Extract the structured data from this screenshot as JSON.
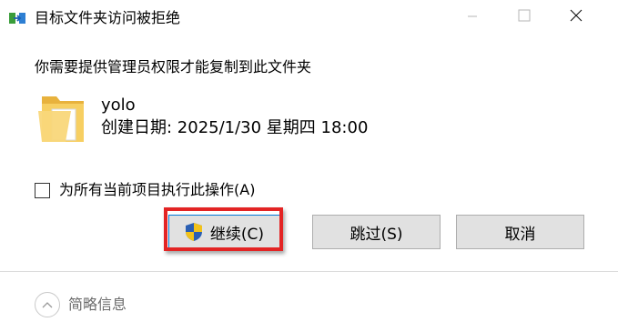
{
  "window": {
    "title": "目标文件夹访问被拒绝"
  },
  "dialog": {
    "prompt": "你需要提供管理员权限才能复制到此文件夹",
    "item": {
      "name": "yolo",
      "created": "创建日期: 2025/1/30 星期四 18:00"
    },
    "checkbox": {
      "label": "为所有当前项目执行此操作(A)",
      "checked": false
    },
    "buttons": {
      "continue": "继续(C)",
      "skip": "跳过(S)",
      "cancel": "取消"
    },
    "details_toggle": "简略信息"
  },
  "icons": {
    "title": "copy-arrow-icon",
    "folder": "folder-icon",
    "shield": "uac-shield-icon",
    "minimize": "minimize-icon",
    "maximize": "maximize-icon",
    "close": "close-icon",
    "chevron": "chevron-up-icon"
  },
  "colors": {
    "highlight": "#e32424",
    "button_bg": "#e1e1e1",
    "focus_border": "#0078d7",
    "folder": "#f5c85a"
  }
}
